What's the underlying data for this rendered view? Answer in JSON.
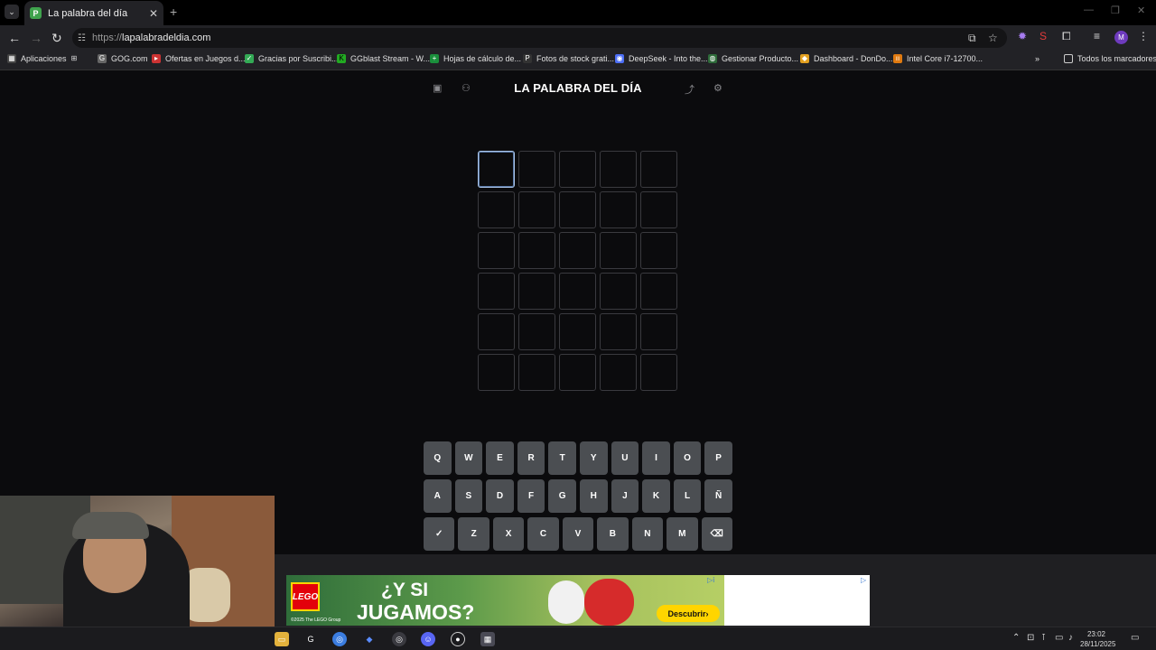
{
  "browser": {
    "tab_title": "La palabra del día",
    "favicon_letter": "P",
    "url_scheme": "https://",
    "url_host": "lapalabradeldia.com",
    "profile_initial": "M"
  },
  "bookmarks": [
    {
      "label": "Aplicaciones"
    },
    {
      "label": "GOG.com"
    },
    {
      "label": "Ofertas en Juegos d..."
    },
    {
      "label": "Gracias por Suscribi..."
    },
    {
      "label": "GGblast Stream - W..."
    },
    {
      "label": "Hojas de cálculo de..."
    },
    {
      "label": "Fotos de stock grati..."
    },
    {
      "label": "DeepSeek - Into the..."
    },
    {
      "label": "Gestionar Producto..."
    },
    {
      "label": "Dashboard - DonDo..."
    },
    {
      "label": "Intel Core i7-12700..."
    }
  ],
  "bookmarks_all": "Todos los marcadores",
  "game": {
    "title": "LA PALABRA DEL DÍA",
    "rows": 6,
    "cols": 5
  },
  "keyboard": {
    "row1": [
      "Q",
      "W",
      "E",
      "R",
      "T",
      "Y",
      "U",
      "I",
      "O",
      "P"
    ],
    "row2": [
      "A",
      "S",
      "D",
      "F",
      "G",
      "H",
      "J",
      "K",
      "L",
      "Ñ"
    ],
    "row3": [
      "Z",
      "X",
      "C",
      "V",
      "B",
      "N",
      "M"
    ],
    "enter_icon": "✓",
    "backspace_icon": "⌫"
  },
  "ad": {
    "brand": "LEGO",
    "headline_1": "¿Y SI",
    "headline_2": "JUGAMOS?",
    "cta": "Descubrir›",
    "copyright": "©2025 The LEGO Group"
  },
  "taskbar": {
    "time": "23:02",
    "date": "28/11/2025"
  },
  "colors": {
    "page_bg": "#0b0b0d",
    "cell_border": "#3a3a3f",
    "active_cell_border": "#a9c3e6",
    "key_bg": "#4b4e52"
  }
}
